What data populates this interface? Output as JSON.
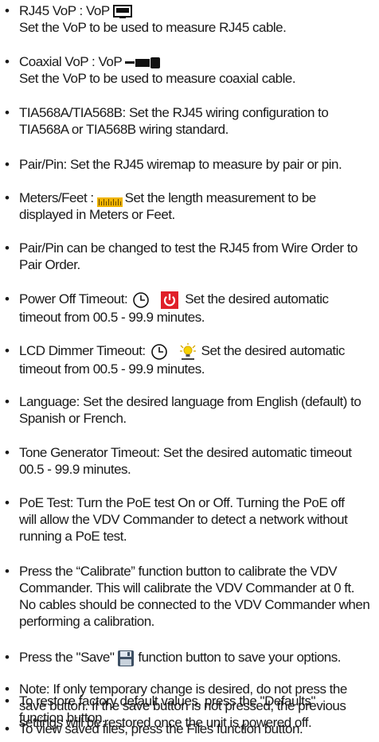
{
  "items": [
    {
      "lines": [
        [
          "RJ45 VoP : VoP",
          "@monitor-icon"
        ],
        [
          "Set the VoP to be used to measure RJ45 cable."
        ]
      ]
    },
    {
      "lines": [
        [
          "Coaxial VoP : VoP",
          "@coax-icon"
        ],
        [
          "Set the VoP to be used to measure coaxial cable."
        ]
      ]
    },
    {
      "lines": [
        [
          "TIA568A/TIA568B: Set the RJ45 wiring configuration to"
        ],
        [
          "TIA568A or TIA568B wiring standard."
        ]
      ]
    },
    {
      "lines": [
        [
          "Pair/Pin: Set the RJ45 wiremap to measure by pair or pin."
        ]
      ]
    },
    {
      "lines": [
        [
          "Meters/Feet :",
          "@ruler-icon",
          "Set the length measurement to be"
        ],
        [
          "displayed in Meters or Feet."
        ]
      ]
    },
    {
      "lines": [
        [
          "Pair/Pin can be changed to test the RJ45 from Wire Order to"
        ],
        [
          "Pair Order."
        ]
      ]
    },
    {
      "lines": [
        [
          "Power Off Timeout:",
          "@clock-icon",
          "@power-icon",
          "Set the desired automatic"
        ],
        [
          "timeout from 00.5 - 99.9 minutes."
        ]
      ]
    },
    {
      "lines": [
        [
          "LCD Dimmer Timeout:",
          "@clock-icon",
          "@bulb-icon",
          "Set the desired automatic"
        ],
        [
          "timeout from 00.5 - 99.9 minutes."
        ]
      ]
    },
    {
      "lines": [
        [
          "Language: Set the desired language from English (default) to"
        ],
        [
          "Spanish or French."
        ]
      ]
    },
    {
      "lines": [
        [
          "Tone Generator Timeout: Set the desired automatic timeout"
        ],
        [
          "00.5 - 99.9 minutes."
        ]
      ]
    },
    {
      "lines": [
        [
          "PoE Test: Turn the PoE test On or Off. Turning the PoE off"
        ],
        [
          "will allow the VDV Commander to detect a network without"
        ],
        [
          "running a PoE test."
        ]
      ]
    },
    {
      "lines": [
        [
          "Press the “Calibrate” function button to calibrate the VDV"
        ],
        [
          "Commander. This will calibrate the VDV Commander at 0 ft."
        ],
        [
          "No cables should be connected to the VDV Commander when"
        ],
        [
          "performing a calibration."
        ]
      ]
    },
    {
      "lines": [
        [
          "Press the \"Save\"",
          "@floppy-icon",
          "function button to save your options."
        ]
      ]
    },
    {
      "lines": [
        [
          "Note: If only temporary change is desired, do not press the"
        ],
        [
          "save button. If the save button is not pressed, the previous"
        ],
        [
          "settings will be restored once the unit is powered off."
        ]
      ]
    },
    {
      "lines": [
        [
          "To restore factory default values, press the \"Defaults\""
        ],
        [
          "function button."
        ]
      ]
    },
    {
      "lines": [
        [
          "To view saved files, press the Files function button."
        ]
      ]
    }
  ],
  "bullet": "•",
  "colors": {
    "text": "#1a1a1a",
    "ruler": "#f0b400",
    "power": "#e0202a",
    "bulb": "#d8a800"
  }
}
